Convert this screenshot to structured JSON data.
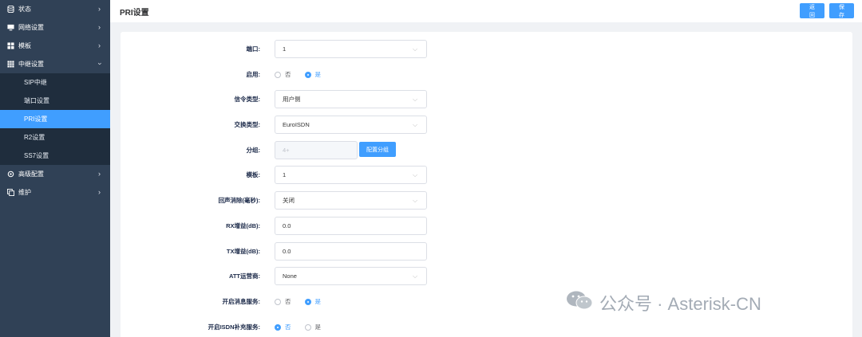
{
  "sidebar": {
    "items": [
      {
        "label": "状态",
        "icon": "database-icon"
      },
      {
        "label": "网络设置",
        "icon": "monitor-icon"
      },
      {
        "label": "模板",
        "icon": "grid-icon"
      },
      {
        "label": "中继设置",
        "icon": "apps-icon"
      },
      {
        "label": "高级配置",
        "icon": "gear-icon"
      },
      {
        "label": "维护",
        "icon": "copy-icon"
      }
    ],
    "submenu": [
      "SIP中继",
      "端口设置",
      "PRI设置",
      "R2设置",
      "SS7设置"
    ]
  },
  "header": {
    "title": "PRI设置",
    "back_label": "返回",
    "save_label": "保存"
  },
  "form": {
    "port": {
      "label": "端口:",
      "value": "1"
    },
    "enable": {
      "label": "启用:",
      "options": [
        "否",
        "是"
      ],
      "selected": "是"
    },
    "signaling": {
      "label": "信令类型:",
      "value": "用户侧"
    },
    "switch_type": {
      "label": "交换类型:",
      "value": "EuroISDN"
    },
    "group": {
      "label": "分组:",
      "placeholder": "4+",
      "button": "配置分组"
    },
    "template": {
      "label": "模板:",
      "value": "1"
    },
    "echo_cancel": {
      "label": "回声消除(毫秒):",
      "value": "关闭"
    },
    "rx_gain": {
      "label": "RX增益(dB):",
      "value": "0.0"
    },
    "tx_gain": {
      "label": "TX增益(dB):",
      "value": "0.0"
    },
    "att_operator": {
      "label": "ATT运营商:",
      "value": "None"
    },
    "msg_service": {
      "label": "开启消息服务:",
      "options": [
        "否",
        "是"
      ],
      "selected": "是"
    },
    "isdn_supp": {
      "label": "开启ISDN补充服务:",
      "options": [
        "否",
        "是"
      ],
      "selected": "否"
    }
  },
  "watermark": {
    "text": "公众号 · Asterisk-CN"
  }
}
